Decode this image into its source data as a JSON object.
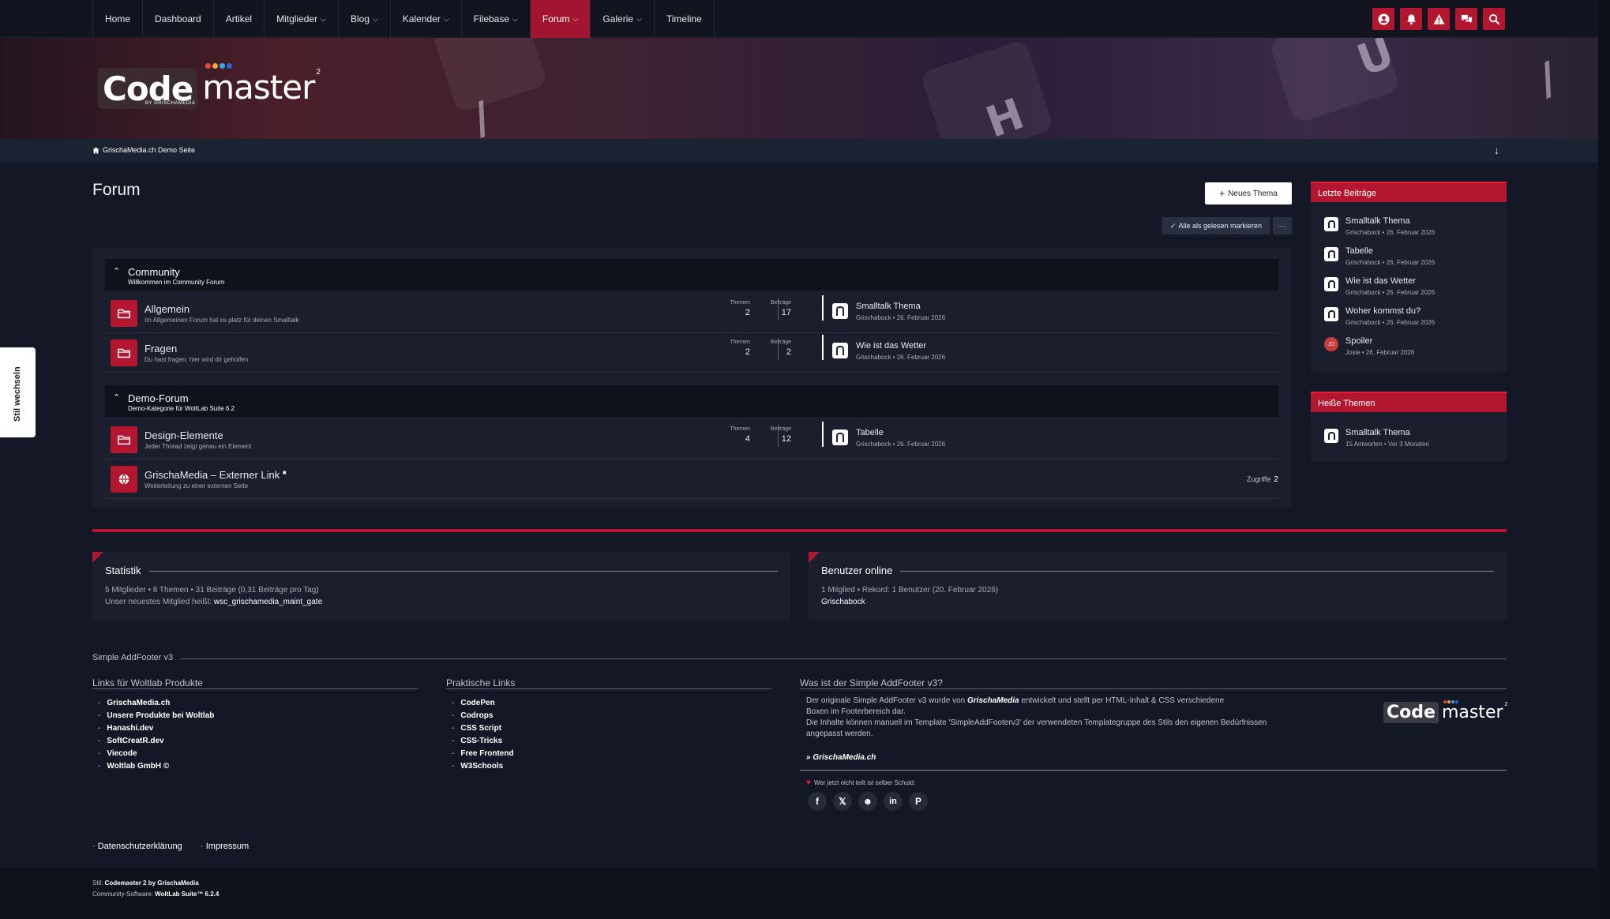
{
  "nav": {
    "items": [
      {
        "label": "Home",
        "dropdown": false
      },
      {
        "label": "Dashboard",
        "dropdown": false
      },
      {
        "label": "Artikel",
        "dropdown": false
      },
      {
        "label": "Mitglieder",
        "dropdown": true
      },
      {
        "label": "Blog",
        "dropdown": true
      },
      {
        "label": "Kalender",
        "dropdown": true
      },
      {
        "label": "Filebase",
        "dropdown": true
      },
      {
        "label": "Forum",
        "dropdown": true,
        "active": true
      },
      {
        "label": "Galerie",
        "dropdown": true
      },
      {
        "label": "Timeline",
        "dropdown": false
      }
    ],
    "icons": [
      "user-icon",
      "bell-icon",
      "warning-icon",
      "chat-icon",
      "search-icon"
    ]
  },
  "logo": {
    "code": "Code",
    "master": "master",
    "sup": "2",
    "sub": "BY GRISCHAMEDIA"
  },
  "breadcrumb": {
    "label": "GrischaMedia.ch Demo Seite",
    "arrow": "↓"
  },
  "page": {
    "title": "Forum",
    "new_thread": "Neues Thema",
    "mark_read": "Alle als gelesen markieren",
    "more": "···"
  },
  "style_switch": "Stil wechseln",
  "categories": [
    {
      "title": "Community",
      "desc": "Willkommen im Community Forum",
      "boards": [
        {
          "title": "Allgemein",
          "desc": "Im Allgemeinen Forum hat es platz für deinen Smalltalk",
          "themen_label": "Themen",
          "themen": "2",
          "beitraege_label": "Beiträge",
          "beitraege": "17",
          "last_title": "Smalltalk Thema",
          "last_meta": "Grischabock • 26. Februar 2026"
        },
        {
          "title": "Fragen",
          "desc": "Du hast fragen, hier wird dir geholfen",
          "themen_label": "Themen",
          "themen": "2",
          "beitraege_label": "Beiträge",
          "beitraege": "2",
          "last_title": "Wie ist das Wetter",
          "last_meta": "Grischabock • 26. Februar 2026"
        }
      ]
    },
    {
      "title": "Demo-Forum",
      "desc": "Demo-Kategorie für WoltLab Suite 6.2",
      "boards": [
        {
          "title": "Design-Elemente",
          "desc": "Jeder Thread zeigt genau ein Element",
          "themen_label": "Themen",
          "themen": "4",
          "beitraege_label": "Beiträge",
          "beitraege": "12",
          "last_title": "Tabelle",
          "last_meta": "Grischabock • 26. Februar 2026"
        },
        {
          "title": "GrischaMedia – Externer Link",
          "desc": "Weiterleitung zu einer externen Seite",
          "hits_label": "Zugriffe",
          "hits": "2"
        }
      ]
    }
  ],
  "sidebar": {
    "recent": {
      "title": "Letzte Beiträge",
      "items": [
        {
          "title": "Smalltalk Thema",
          "meta": "Grischabock • 26. Februar 2026"
        },
        {
          "title": "Tabelle",
          "meta": "Grischabock • 26. Februar 2026"
        },
        {
          "title": "Wie ist das Wetter",
          "meta": "Grischabock • 26. Februar 2026"
        },
        {
          "title": "Woher kommst du?",
          "meta": "Grischabock • 26. Februar 2026"
        },
        {
          "title": "Spoiler",
          "meta": "Josie • 26. Februar 2026",
          "avatar": "JO"
        }
      ]
    },
    "hot": {
      "title": "Heiße Themen",
      "items": [
        {
          "title": "Smalltalk Thema",
          "meta": "15 Antworten • Vor 3 Monaten"
        }
      ]
    }
  },
  "statistik": {
    "title": "Statistik",
    "line1": "5 Mitglieder  •  8 Themen  •  31 Beiträge (0,31 Beiträge pro Tag)",
    "line2_prefix": "Unser neuestes Mitglied heißt: ",
    "newest": "wsc_grischamedia_maint_gate"
  },
  "online": {
    "title": "Benutzer online",
    "line1": "1 Mitglied  •  Rekord: 1 Benutzer (20. Februar 2026)",
    "user": "Grischabock"
  },
  "footer": {
    "title": "Simple AddFooter v3",
    "col1": {
      "title": "Links für Woltlab Produkte",
      "items": [
        "GrischaMedia.ch",
        "Unsere Produkte bei Woltlab",
        "Hanashi.dev",
        "SoftCreatR.dev",
        "Viecode",
        "Woltlab GmbH ©"
      ]
    },
    "col2": {
      "title": "Praktische Links",
      "items": [
        "CodePen",
        "Codrops",
        "CSS Script",
        "CSS-Tricks",
        "Free Frontend",
        "W3Schools"
      ]
    },
    "col3": {
      "title": "Was ist der Simple AddFooter v3?",
      "p1_a": "Der originale Simple AddFooter v3 wurde von ",
      "p1_b": "GrischaMedia",
      "p1_c": " entwickelt und stellt per HTML-Inhalt & CSS verschiedene Boxen im Footerbereich dar.",
      "p2": "Die Inhalte können manuell im Template 'SimpleAddFooterv3' der verwendeten Templategruppe des Stils den eigenen Bedürfnissen angepasst werden.",
      "link": "» GrischaMedia.ch",
      "share": "Wer jetzt nicht teilt ist selber Schuld:",
      "socials": [
        "facebook-icon",
        "x-icon",
        "reddit-icon",
        "linkedin-icon",
        "pinterest-icon"
      ]
    },
    "legal": [
      "Datenschutzerklärung",
      "Impressum"
    ],
    "style_label": "Stil: ",
    "style_value": "Codemaster 2 by GrischaMedia",
    "software_label": "Community-Software: ",
    "software_value": "WoltLab Suite™ 6.2.4"
  },
  "colors": {
    "accent": "#b3172f",
    "background": "#141826",
    "panel": "#1b1f2d"
  }
}
